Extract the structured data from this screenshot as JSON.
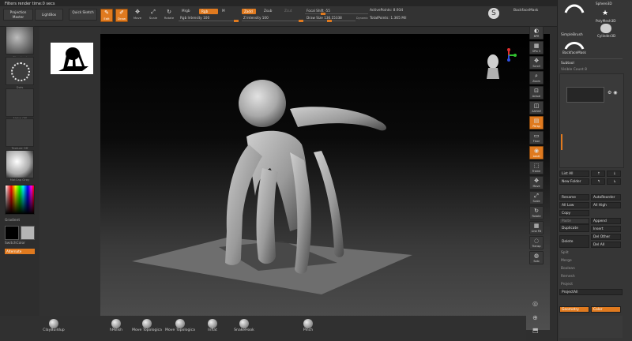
{
  "window": {
    "title": "Filters render time:0 secs"
  },
  "toolbar": {
    "projection_master": "Projection Master",
    "lightbox": "LightBox",
    "quick_sketch": "Quick Sketch",
    "edit": "Edit",
    "draw": "Draw",
    "move": "Move",
    "scale": "Scale",
    "rotate": "Rotate",
    "mrgb": "Mrgb",
    "rgb": "Rgb",
    "m": "M",
    "zadd": "Zadd",
    "zsub": "Zsub",
    "zcut": "Zcut",
    "rgb_intensity": "Rgb Intensity 100",
    "z_intensity": "Z Intensity 100",
    "focal_shift": "Focal Shift -55",
    "draw_size": "Draw Size 136.15338",
    "dynamic": "Dynamic",
    "active_points": "ActivePoints: 8.934",
    "total_points": "TotalPoints: 1.365 Mil",
    "backface_mask": "BackfaceMask"
  },
  "left_panel": {
    "brush_label": "Standard",
    "stroke_label": "Dots",
    "alpha_label": "Alpha Off",
    "texture_label": "Texture Off",
    "material_label": "MatCap Gray",
    "gradient_label": "Gradient",
    "switch_color": "SwitchColor",
    "alternate": "Alternate"
  },
  "right_toolbar": [
    {
      "label": "BPR",
      "icon": "◐"
    },
    {
      "label": "SPix 3",
      "icon": "▦"
    },
    {
      "label": "Scroll",
      "icon": "✥"
    },
    {
      "label": "Zoom",
      "icon": "⌕"
    },
    {
      "label": "Actual",
      "icon": "⊡"
    },
    {
      "label": "AAHalf",
      "icon": "◫"
    },
    {
      "label": "Persp",
      "icon": "▤"
    },
    {
      "label": "Floor",
      "icon": "▭"
    },
    {
      "label": "Local",
      "icon": "◉"
    },
    {
      "label": "Frame",
      "icon": "⬚"
    },
    {
      "label": "Move",
      "icon": "✥"
    },
    {
      "label": "Scale",
      "icon": "⤢"
    },
    {
      "label": "Rotate",
      "icon": "↻"
    },
    {
      "label": "Line Fill",
      "icon": "▦"
    },
    {
      "label": "Transp",
      "icon": "◌"
    },
    {
      "label": "Solo",
      "icon": "◍"
    }
  ],
  "right_palette": {
    "tools": [
      "SimpleBrush",
      "Cylinder3D",
      "PolyMesh3D",
      "Sphere3D",
      "BackfaceMask"
    ],
    "subtool": "Subtool",
    "visible_count": "Visible Count 8",
    "list_all": "List All",
    "new_folder": "New Folder",
    "rename": "Rename",
    "auto_reorder": "AutoReorder",
    "all_low": "All Low",
    "all_high": "All High",
    "copy": "Copy",
    "paste": "Paste",
    "duplicate": "Duplicate",
    "append": "Append",
    "insert": "Insert",
    "delete": "Delete",
    "del_other": "Del Other",
    "del_all": "Del All",
    "split": "Split",
    "merge": "Merge",
    "boolean": "Boolean",
    "remesh": "Remesh",
    "project": "Project",
    "project_all": "ProjectAll",
    "geometry": "Geometry",
    "color": "Color"
  },
  "bottom_shelf": [
    {
      "label": "ClayBuildup"
    },
    {
      "label": "hPolish"
    },
    {
      "label": "Move Topologica"
    },
    {
      "label": "Move Topologica"
    },
    {
      "label": "Inflat"
    },
    {
      "label": "SnakeHook"
    },
    {
      "label": "Pinch"
    }
  ],
  "colors": {
    "accent": "#e07a1f",
    "panel": "#333333",
    "viewport_top": "#000000"
  }
}
